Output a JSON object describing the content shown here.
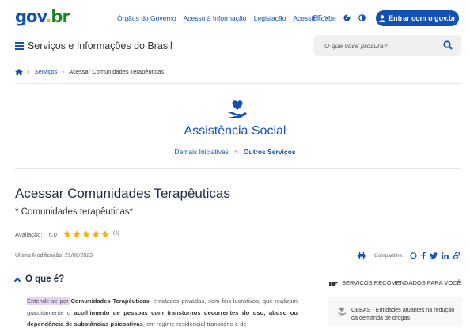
{
  "header": {
    "logo": {
      "part1": "gov",
      "part2": ".",
      "part3": "br"
    },
    "links": [
      "Órgãos do Governo",
      "Acesso à Informação",
      "Legislação",
      "Acessibilidade"
    ],
    "language": "PT",
    "login_label": "Entrar com o gov.br",
    "colors": {
      "primary": "#1351b4",
      "logo_yellow": "#f8b400",
      "logo_green": "#168821"
    }
  },
  "subheader": {
    "site_title": "Serviços e Informações do Brasil",
    "search_placeholder": "O que você procura?"
  },
  "breadcrumb": {
    "items": [
      "Serviços",
      "Acessar Comunidades Terapêuticas"
    ]
  },
  "hero": {
    "icon": "heart-hand-icon",
    "title": "Assistência Social",
    "crumbs": [
      "Demais Iniciativas",
      ">",
      "Outros Serviços"
    ]
  },
  "service": {
    "title": "Acessar Comunidades Terapêuticas",
    "subtitle": "* Comunidades terapêuticas*",
    "rating_label": "Avaliação:",
    "rating_value": "5.0",
    "rating_stars": 5,
    "rating_count": "(1)",
    "last_modified": "Última Modificação: 21/08/2023",
    "share_label": "Compartilhe:",
    "star_color": "#f8b400"
  },
  "accordion": {
    "title": "O que é?",
    "p1": "Entende-se por ",
    "b1": "Comunidades Terapêuticas",
    "p2": ", entidades privadas, sem fins lucrativos, que realizam gratuitamente o ",
    "b2": "acolhimento de pessoas com transtornos decorrentes do uso, abuso ou dependência de substâncias psicoativas",
    "p3": ", em regime residencial transitório e de",
    "highlight_color": "#e5d4f5"
  },
  "sidebar": {
    "heading": "SERVIÇOS RECOMENDADOS PARA VOCÊ",
    "items": [
      {
        "title": "CEBAS - Entidades atuantes na redução da demanda de drogas"
      }
    ]
  }
}
